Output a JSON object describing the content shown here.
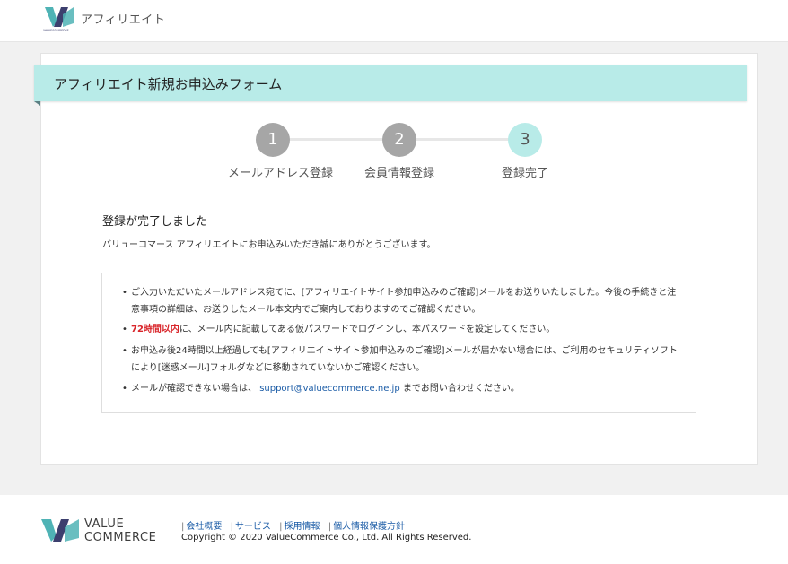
{
  "header": {
    "brand_small": "VALUECOMMERCE",
    "title": "アフィリエイト"
  },
  "form": {
    "title": "アフィリエイト新規お申込みフォーム",
    "steps": [
      {
        "number": "1",
        "label": "メールアドレス登録",
        "state": "done"
      },
      {
        "number": "2",
        "label": "会員情報登録",
        "state": "done"
      },
      {
        "number": "3",
        "label": "登録完了",
        "state": "active"
      }
    ],
    "done_heading": "登録が完了しました",
    "thanks": "バリューコマース アフィリエイトにお申込みいただき誠にありがとうございます。"
  },
  "info": {
    "item1_line1": "ご入力いただいたメールアドレス宛てに、[アフィリエイトサイト参加申込みのご確認]メールをお送りいたしました。今後の手続きと注",
    "item1_line2": "意事項の詳細は、お送りしたメール本文内でご案内しておりますのでご確認ください。",
    "item2_emphasis": "72時間以内",
    "item2_rest": "に、メール内に記載してある仮パスワードでログインし、本パスワードを設定してください。",
    "item3_line1": "お申込み後24時間以上経過しても[アフィリエイトサイト参加申込みのご確認]メールが届かない場合には、ご利用のセキュリティソフト",
    "item3_line2": "により[迷惑メール]フォルダなどに移動されていないかご確認ください。",
    "item4_before": "メールが確認できない場合は、",
    "item4_email": "support@valuecommerce.ne.jp",
    "item4_after": " までお問い合わせください。"
  },
  "footer": {
    "brand_line1": "VALUE",
    "brand_line2": "COMMERCE",
    "links": [
      "会社概要",
      "サービス",
      "採用情報",
      "個人情報保護方針"
    ],
    "copyright": "Copyright © 2020 ValueCommerce Co., Ltd. All Rights Reserved."
  },
  "colors": {
    "accent": "#b8ebe8",
    "step_done": "#a6a6a6",
    "link": "#1a5ba6",
    "emphasis": "#d9252a",
    "logo_teal": "#4fb3b5",
    "logo_navy": "#3c3f6e"
  }
}
